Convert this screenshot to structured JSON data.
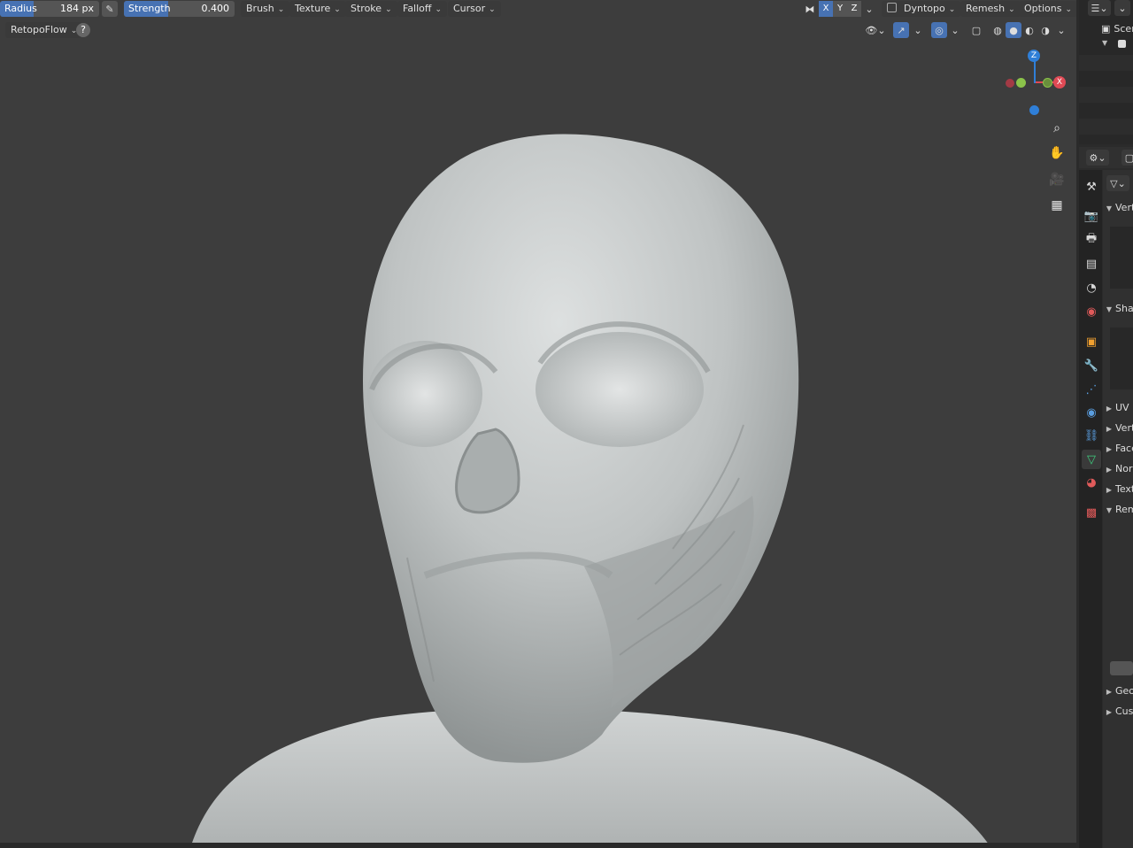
{
  "header": {
    "radius": {
      "label": "Radius",
      "value": "184 px"
    },
    "strength": {
      "label": "Strength",
      "value": "0.400"
    },
    "menus": [
      "Brush",
      "Texture",
      "Stroke",
      "Falloff",
      "Cursor"
    ],
    "axes": [
      "X",
      "Y",
      "Z"
    ],
    "dyntopo_label": "Dyntopo",
    "remesh_label": "Remesh",
    "options_label": "Options"
  },
  "addon": {
    "label": "RetopoFlow",
    "help": "?"
  },
  "gizmo": {
    "z": "Z",
    "x": "X"
  },
  "outliner": {
    "scene_label": "Scene"
  },
  "properties": {
    "rows": [
      {
        "arrow": "▼",
        "label": "Vertex Groups"
      },
      {
        "arrow": "▼",
        "label": "Shape Keys"
      },
      {
        "arrow": "▶",
        "label": "UV Maps"
      },
      {
        "arrow": "▶",
        "label": "Vertex Colors"
      },
      {
        "arrow": "▶",
        "label": "Face Maps"
      },
      {
        "arrow": "▶",
        "label": "Normals"
      },
      {
        "arrow": "▶",
        "label": "Texture Space"
      },
      {
        "arrow": "▼",
        "label": "Remesh"
      },
      {
        "arrow": "▶",
        "label": "Geometry Data"
      },
      {
        "arrow": "▶",
        "label": "Custom Properties"
      }
    ]
  },
  "colors": {
    "accent": "#4772b3",
    "axis_x": "#e04a55",
    "axis_y": "#8bc34a",
    "axis_z": "#2f7fd8",
    "mesh": "#b8bcbc",
    "viewport_bg": "#3d3d3d"
  }
}
